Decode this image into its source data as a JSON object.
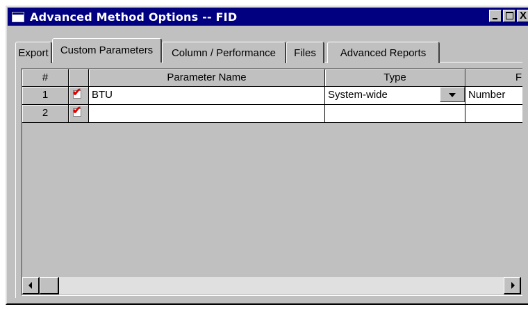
{
  "window": {
    "title": "Advanced Method Options -- FID",
    "close_glyph": "X"
  },
  "tabs": [
    {
      "label": "Export"
    },
    {
      "label": "Custom Parameters"
    },
    {
      "label": "Column / Performance"
    },
    {
      "label": "Files"
    },
    {
      "label": "Advanced Reports"
    }
  ],
  "active_tab": "Custom Parameters",
  "grid": {
    "columns": [
      "#",
      "",
      "Parameter Name",
      "Type",
      "F"
    ],
    "rows": [
      {
        "num": "1",
        "checked": true,
        "name": "BTU",
        "type": "System-wide",
        "format": "Number"
      },
      {
        "num": "2",
        "checked": true,
        "name": "",
        "type": "",
        "format": ""
      }
    ]
  },
  "colors": {
    "titlebar": "#000080",
    "face": "#c0c0c0",
    "checkmark": "#e00000"
  }
}
